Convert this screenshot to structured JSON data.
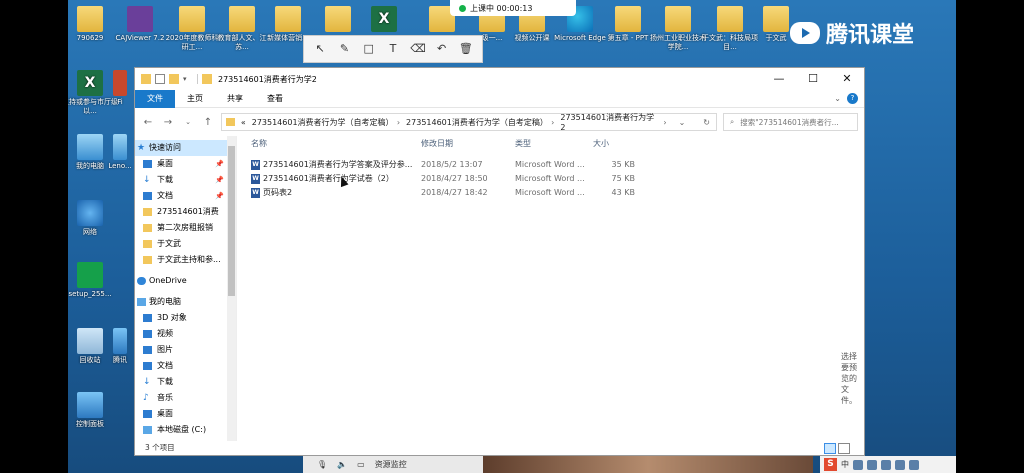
{
  "recording": {
    "label": "上课中 00:00:13"
  },
  "tencent": {
    "brand": "腾讯课堂"
  },
  "desktop_icons": [
    {
      "label": "790629"
    },
    {
      "label": "CAJViewer 7.2"
    },
    {
      "label": "2020年度教师科研工..."
    },
    {
      "label": "教育部人文、江苏..."
    },
    {
      "label": "新媒体营销..."
    },
    {
      "label": "主持或参与市厅级以..."
    },
    {
      "label": "我的电脑"
    },
    {
      "label": "网络"
    },
    {
      "label": "setup_255..."
    },
    {
      "label": "回收站"
    },
    {
      "label": "控制面板"
    },
    {
      "label": "视频公开课"
    },
    {
      "label": "Microsoft Edge"
    },
    {
      "label": "第五章 - PPT"
    },
    {
      "label": "扬州工业职业技术学院..."
    },
    {
      "label": "于文武：科技局项目..."
    },
    {
      "label": "于文武"
    },
    {
      "label": "级一..."
    },
    {
      "label": "Fi"
    },
    {
      "label": "Leno..."
    },
    {
      "label": "腾讯"
    }
  ],
  "explorer": {
    "title": "273514601消费者行为学2",
    "ribbon_tabs": [
      "文件",
      "主页",
      "共享",
      "查看"
    ],
    "breadcrumb": [
      "273514601消费者行为学（自考定稿）",
      "273514601消费者行为学（自考定稿）",
      "273514601消费者行为学2"
    ],
    "breadcrumb_prefix": "«",
    "search_placeholder": "搜索\"273514601消费者行...",
    "nav": [
      {
        "label": "快速访问",
        "icon": "star-icon",
        "level": 0,
        "pinned": false
      },
      {
        "label": "桌面",
        "icon": "desktop-folder-icon",
        "level": 1,
        "pinned": true
      },
      {
        "label": "下载",
        "icon": "download-icon",
        "level": 1,
        "pinned": true
      },
      {
        "label": "文档",
        "icon": "document-icon",
        "level": 1,
        "pinned": true
      },
      {
        "label": "273514601消费",
        "icon": "folder-icon",
        "level": 1,
        "pinned": false
      },
      {
        "label": "第二次房租报销",
        "icon": "folder-icon",
        "level": 1,
        "pinned": false
      },
      {
        "label": "于文武",
        "icon": "folder-icon",
        "level": 1,
        "pinned": false
      },
      {
        "label": "于文武主持和参...",
        "icon": "folder-icon",
        "level": 1,
        "pinned": false
      },
      {
        "label": "OneDrive",
        "icon": "cloud-icon",
        "level": 0,
        "pinned": false
      },
      {
        "label": "我的电脑",
        "icon": "computer-icon",
        "level": 0,
        "pinned": false
      },
      {
        "label": "3D 对象",
        "icon": "cube-icon",
        "level": 1,
        "pinned": false
      },
      {
        "label": "视频",
        "icon": "video-icon",
        "level": 1,
        "pinned": false
      },
      {
        "label": "图片",
        "icon": "picture-icon",
        "level": 1,
        "pinned": false
      },
      {
        "label": "文档",
        "icon": "document-icon",
        "level": 1,
        "pinned": false
      },
      {
        "label": "下载",
        "icon": "download-icon",
        "level": 1,
        "pinned": false
      },
      {
        "label": "音乐",
        "icon": "music-icon",
        "level": 1,
        "pinned": false
      },
      {
        "label": "桌面",
        "icon": "desktop-folder-icon",
        "level": 1,
        "pinned": false
      },
      {
        "label": "本地磁盘 (C:)",
        "icon": "disk-icon",
        "level": 1,
        "pinned": false
      }
    ],
    "columns": {
      "name": "名称",
      "date": "修改日期",
      "type": "类型",
      "size": "大小"
    },
    "files": [
      {
        "name": "273514601消费者行为学答案及评分参...",
        "date": "2018/5/2 13:07",
        "type": "Microsoft Word ...",
        "size": "35 KB"
      },
      {
        "name": "273514601消费者行为学试卷（2）",
        "date": "2018/4/27 18:50",
        "type": "Microsoft Word ...",
        "size": "75 KB"
      },
      {
        "name": "页码表2",
        "date": "2018/4/27 18:42",
        "type": "Microsoft Word ...",
        "size": "43 KB"
      }
    ],
    "preview_hint": "选择要预览的文件。",
    "status": "3 个项目"
  },
  "bottom_strip": {
    "label": "资源监控"
  }
}
